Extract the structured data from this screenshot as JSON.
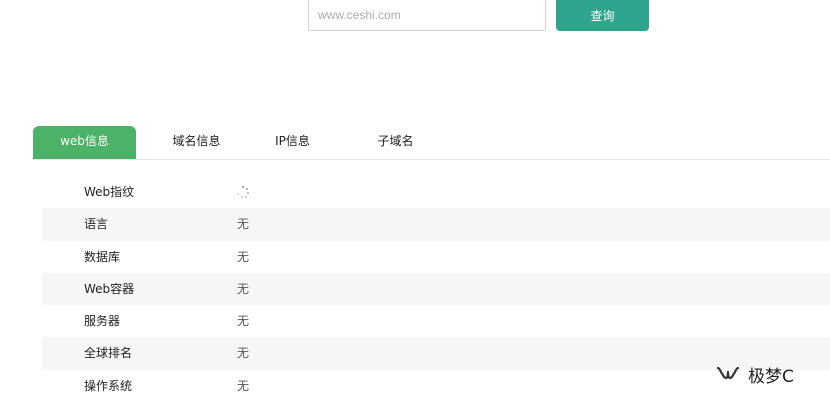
{
  "search": {
    "placeholder": "www.ceshi.com",
    "value": "",
    "button_label": "查询"
  },
  "tabs": [
    {
      "label": "web信息",
      "active": true
    },
    {
      "label": "域名信息",
      "active": false
    },
    {
      "label": "IP信息",
      "active": false
    },
    {
      "label": "子域名",
      "active": false
    }
  ],
  "info_rows": [
    {
      "label": "Web指纹",
      "value": "",
      "loading": true
    },
    {
      "label": "语言",
      "value": "无"
    },
    {
      "label": "数据库",
      "value": "无"
    },
    {
      "label": "Web容器",
      "value": "无"
    },
    {
      "label": "服务器",
      "value": "无"
    },
    {
      "label": "全球排名",
      "value": "无"
    },
    {
      "label": "操作系统",
      "value": "无"
    }
  ],
  "watermark": {
    "text": "极梦C",
    "icon": "wechat-channel-icon"
  },
  "colors": {
    "button": "#2ea58c",
    "active_tab": "#4cb267",
    "stripe": "#f6f6f6"
  }
}
